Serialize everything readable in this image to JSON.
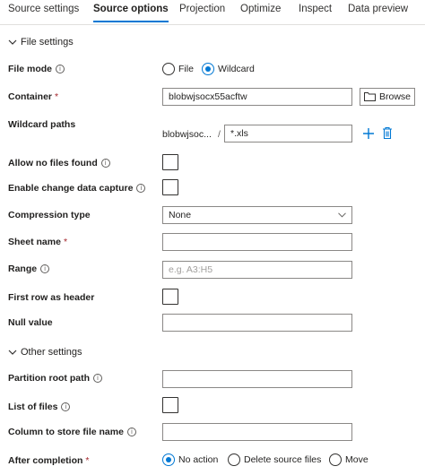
{
  "tabs": [
    {
      "label": "Source settings"
    },
    {
      "label": "Source options"
    },
    {
      "label": "Projection"
    },
    {
      "label": "Optimize"
    },
    {
      "label": "Inspect"
    },
    {
      "label": "Data preview"
    }
  ],
  "active_tab": "Source options",
  "file_settings": {
    "title": "File settings",
    "file_mode": {
      "label": "File mode",
      "options": [
        "File",
        "Wildcard"
      ],
      "selected": "Wildcard"
    },
    "container": {
      "label": "Container",
      "required": "*",
      "value": "blobwjsocx55acftw",
      "browse_label": "Browse"
    },
    "wildcard_paths": {
      "label": "Wildcard paths",
      "prefix": "blobwjsoc...",
      "separator": "/",
      "value": "*.xls"
    },
    "allow_no_files": {
      "label": "Allow no files found",
      "checked": false
    },
    "change_data_capture": {
      "label": "Enable change data capture",
      "checked": false
    },
    "compression_type": {
      "label": "Compression type",
      "value": "None"
    },
    "sheet_name": {
      "label": "Sheet name",
      "required": "*",
      "value": ""
    },
    "range": {
      "label": "Range",
      "placeholder": "e.g. A3:H5"
    },
    "first_row_header": {
      "label": "First row as header",
      "checked": false
    },
    "null_value": {
      "label": "Null value",
      "value": ""
    }
  },
  "other_settings": {
    "title": "Other settings",
    "partition_root_path": {
      "label": "Partition root path",
      "value": ""
    },
    "list_of_files": {
      "label": "List of files",
      "checked": false
    },
    "column_file_name": {
      "label": "Column to store file name",
      "value": ""
    },
    "after_completion": {
      "label": "After completion",
      "required": "*",
      "options": [
        "No action",
        "Delete source files",
        "Move"
      ],
      "selected": "No action"
    }
  },
  "colors": {
    "accent": "#0078d4",
    "required": "#a4262c"
  }
}
